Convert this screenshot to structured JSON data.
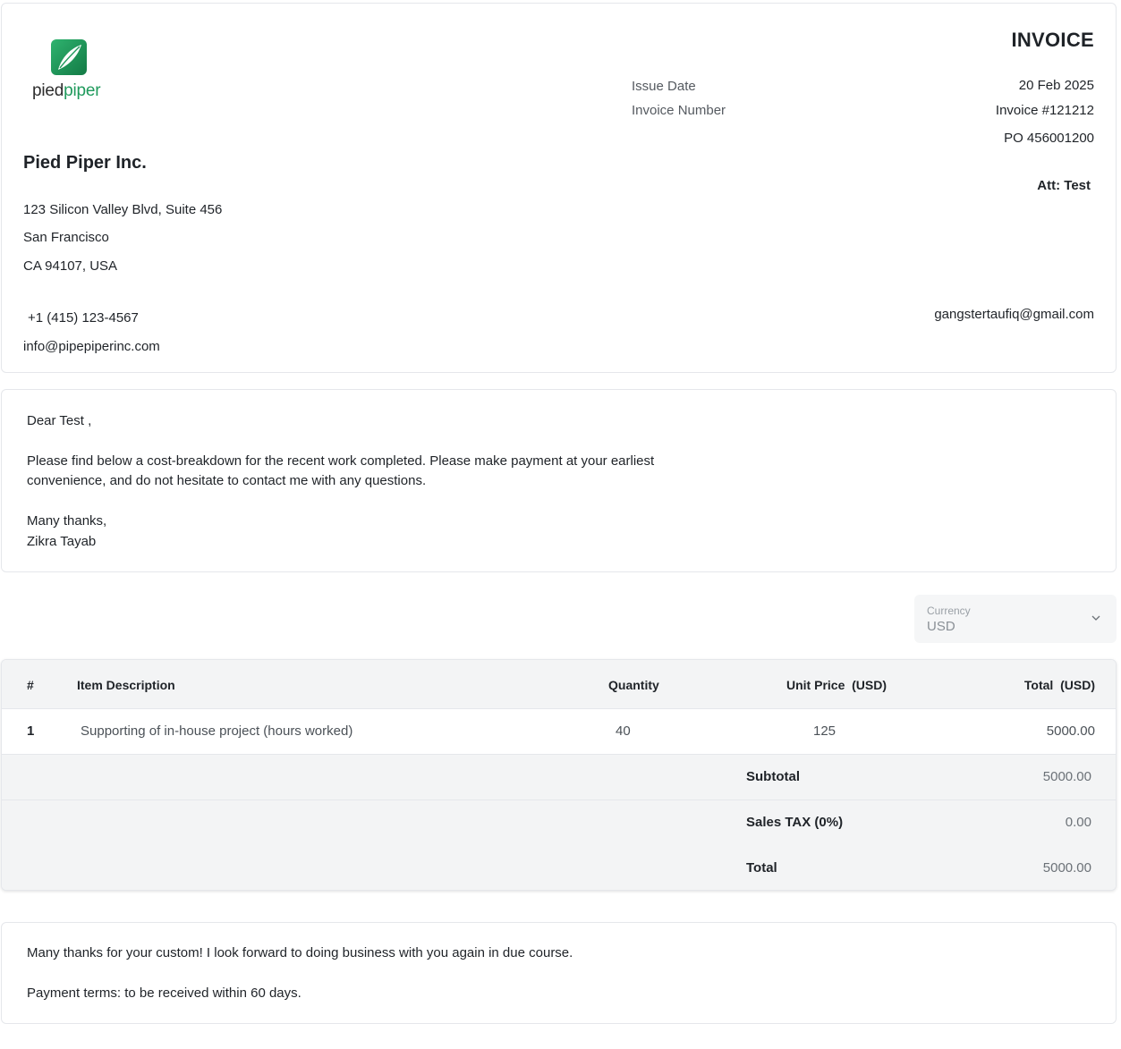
{
  "company": {
    "logo_text_1": "pied",
    "logo_text_2": "piper",
    "name": "Pied Piper Inc.",
    "address_line1": "123 Silicon Valley Blvd, Suite 456",
    "address_line2": "San Francisco",
    "address_line3": "CA 94107, USA",
    "phone": "+1 (415) 123-4567",
    "email": "info@pipepiperinc.com"
  },
  "invoice": {
    "title": "INVOICE",
    "issue_date_label": "Issue Date",
    "issue_date": "20 Feb 2025",
    "number_label": "Invoice Number",
    "number": "Invoice #121212",
    "po": "PO 456001200",
    "attention": "Att: Test",
    "client_email": "gangstertaufiq@gmail.com"
  },
  "letter": {
    "greeting": "Dear Test ,",
    "body": "Please find below a cost-breakdown for the recent work completed. Please make payment at your earliest convenience, and do not hesitate to contact me with any questions.",
    "signoff": "Many thanks,",
    "signature": "Zikra Tayab"
  },
  "currency": {
    "label": "Currency",
    "value": "USD"
  },
  "table": {
    "headers": {
      "index": "#",
      "description": "Item Description",
      "quantity": "Quantity",
      "unit_price": "Unit Price  (USD)",
      "total": "Total  (USD)"
    },
    "items": [
      {
        "index": "1",
        "description": "Supporting of in-house project (hours worked)",
        "quantity": "40",
        "unit_price": "125",
        "total": "5000.00"
      }
    ],
    "subtotal_label": "Subtotal",
    "subtotal": "5000.00",
    "tax_label": "Sales TAX (0%)",
    "tax": "0.00",
    "total_label": "Total",
    "total": "5000.00"
  },
  "footer": {
    "thanks": "Many thanks for your custom! I look forward to doing business with you again in due course.",
    "terms": "Payment terms: to be received within 60 days."
  },
  "colors": {
    "brand_green": "#1f9a5c",
    "table_header_bg": "#f3f4f5"
  }
}
